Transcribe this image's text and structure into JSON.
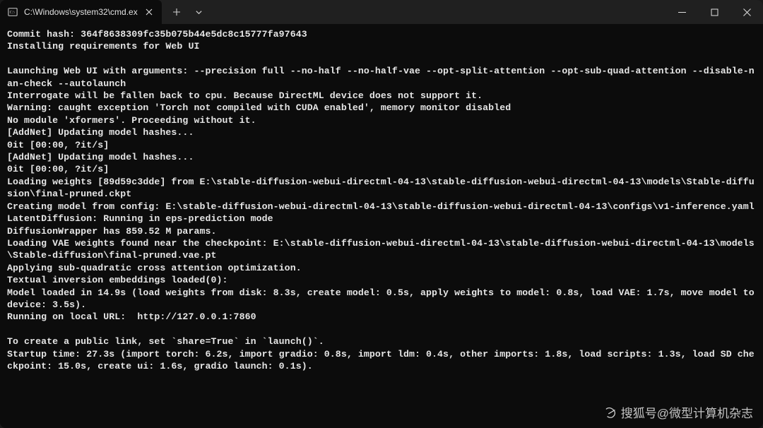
{
  "tab": {
    "title": "C:\\Windows\\system32\\cmd.ex"
  },
  "terminal_lines": [
    "Commit hash: 364f8638309fc35b075b44e5dc8c15777fa97643",
    "Installing requirements for Web UI",
    "",
    "Launching Web UI with arguments: --precision full --no-half --no-half-vae --opt-split-attention --opt-sub-quad-attention --disable-nan-check --autolaunch",
    "Interrogate will be fallen back to cpu. Because DirectML device does not support it.",
    "Warning: caught exception 'Torch not compiled with CUDA enabled', memory monitor disabled",
    "No module 'xformers'. Proceeding without it.",
    "[AddNet] Updating model hashes...",
    "0it [00:00, ?it/s]",
    "[AddNet] Updating model hashes...",
    "0it [00:00, ?it/s]",
    "Loading weights [89d59c3dde] from E:\\stable-diffusion-webui-directml-04-13\\stable-diffusion-webui-directml-04-13\\models\\Stable-diffusion\\final-pruned.ckpt",
    "Creating model from config: E:\\stable-diffusion-webui-directml-04-13\\stable-diffusion-webui-directml-04-13\\configs\\v1-inference.yaml",
    "LatentDiffusion: Running in eps-prediction mode",
    "DiffusionWrapper has 859.52 M params.",
    "Loading VAE weights found near the checkpoint: E:\\stable-diffusion-webui-directml-04-13\\stable-diffusion-webui-directml-04-13\\models\\Stable-diffusion\\final-pruned.vae.pt",
    "Applying sub-quadratic cross attention optimization.",
    "Textual inversion embeddings loaded(0):",
    "Model loaded in 14.9s (load weights from disk: 8.3s, create model: 0.5s, apply weights to model: 0.8s, load VAE: 1.7s, move model to device: 3.5s).",
    "Running on local URL:  http://127.0.0.1:7860",
    "",
    "To create a public link, set `share=True` in `launch()`.",
    "Startup time: 27.3s (import torch: 6.2s, import gradio: 0.8s, import ldm: 0.4s, other imports: 1.8s, load scripts: 1.3s, load SD checkpoint: 15.0s, create ui: 1.6s, gradio launch: 0.1s)."
  ],
  "watermark": "搜狐号@微型计算机杂志"
}
